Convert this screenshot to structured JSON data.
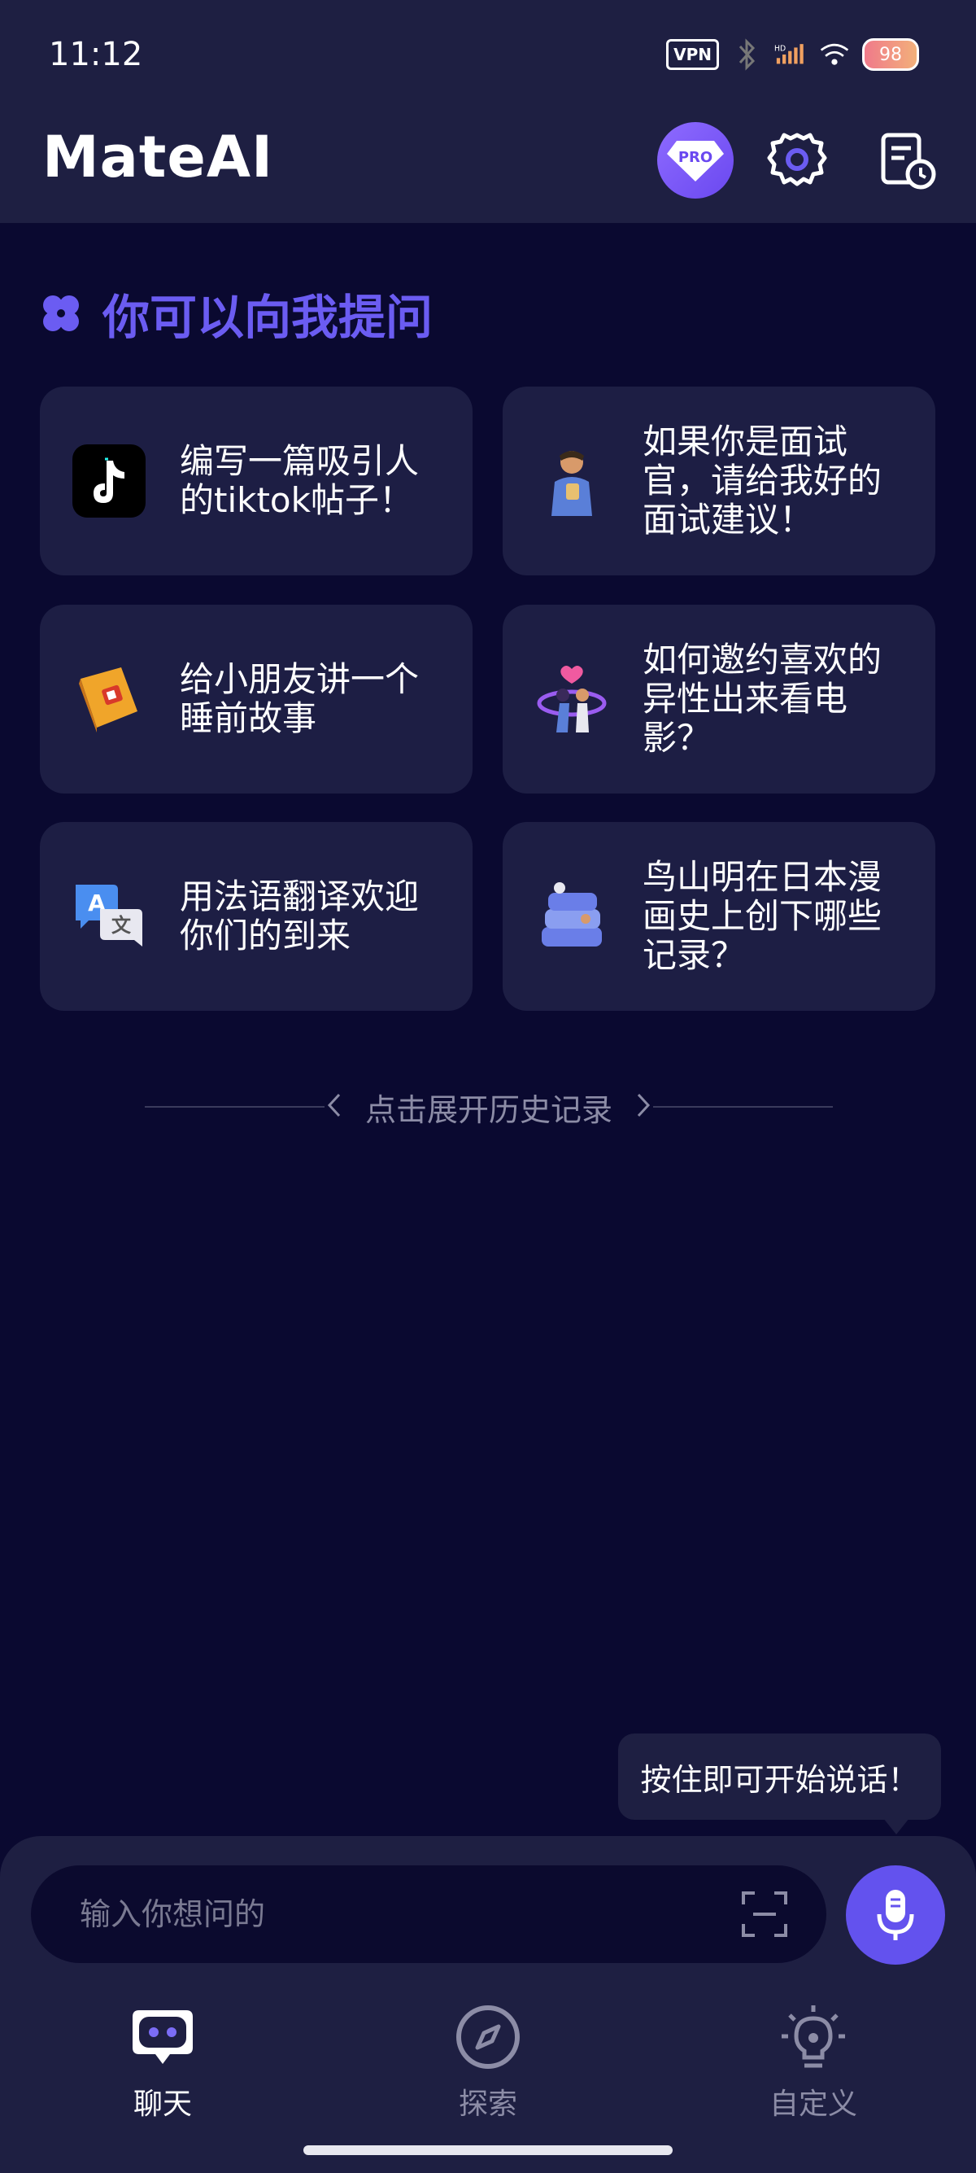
{
  "status_bar": {
    "time": "11:12",
    "vpn": "VPN",
    "battery": "98",
    "icons": [
      "vpn-icon",
      "bluetooth-icon",
      "signal-icon",
      "wifi-icon",
      "battery-icon"
    ]
  },
  "app_bar": {
    "title": "MateAI",
    "pro_label": "PRO",
    "icons": [
      "pro-icon",
      "gear-icon",
      "history-icon"
    ]
  },
  "prompts": {
    "heading": "你可以向我提问",
    "cards": [
      {
        "text": "编写一篇吸引人的tiktok帖子！",
        "icon": "tiktok-icon"
      },
      {
        "text": "如果你是面试官，请给我好的面试建议！",
        "icon": "interviewer-icon"
      },
      {
        "text": "给小朋友讲一个睡前故事",
        "icon": "book-icon"
      },
      {
        "text": "如何邀约喜欢的异性出来看电影？",
        "icon": "romance-icon"
      },
      {
        "text": "用法语翻译欢迎你们的到来",
        "icon": "translate-icon"
      },
      {
        "text": "鸟山明在日本漫画史上创下哪些记录？",
        "icon": "manga-books-icon"
      }
    ]
  },
  "history": {
    "label": "点击展开历史记录"
  },
  "tooltip": "按住即可开始说话！",
  "input": {
    "placeholder": "输入你想问的",
    "value": ""
  },
  "nav": {
    "items": [
      {
        "label": "聊天",
        "icon": "chat-bot-icon",
        "active": true
      },
      {
        "label": "探索",
        "icon": "compass-icon",
        "active": false
      },
      {
        "label": "自定义",
        "icon": "lightbulb-icon",
        "active": false
      }
    ]
  },
  "colors": {
    "background": "#0a0930",
    "panel": "#1e1f42",
    "card": "#1d1e44",
    "accent": "#6352ee",
    "heading": "#6b5cf2",
    "muted": "#8c8ca6"
  }
}
